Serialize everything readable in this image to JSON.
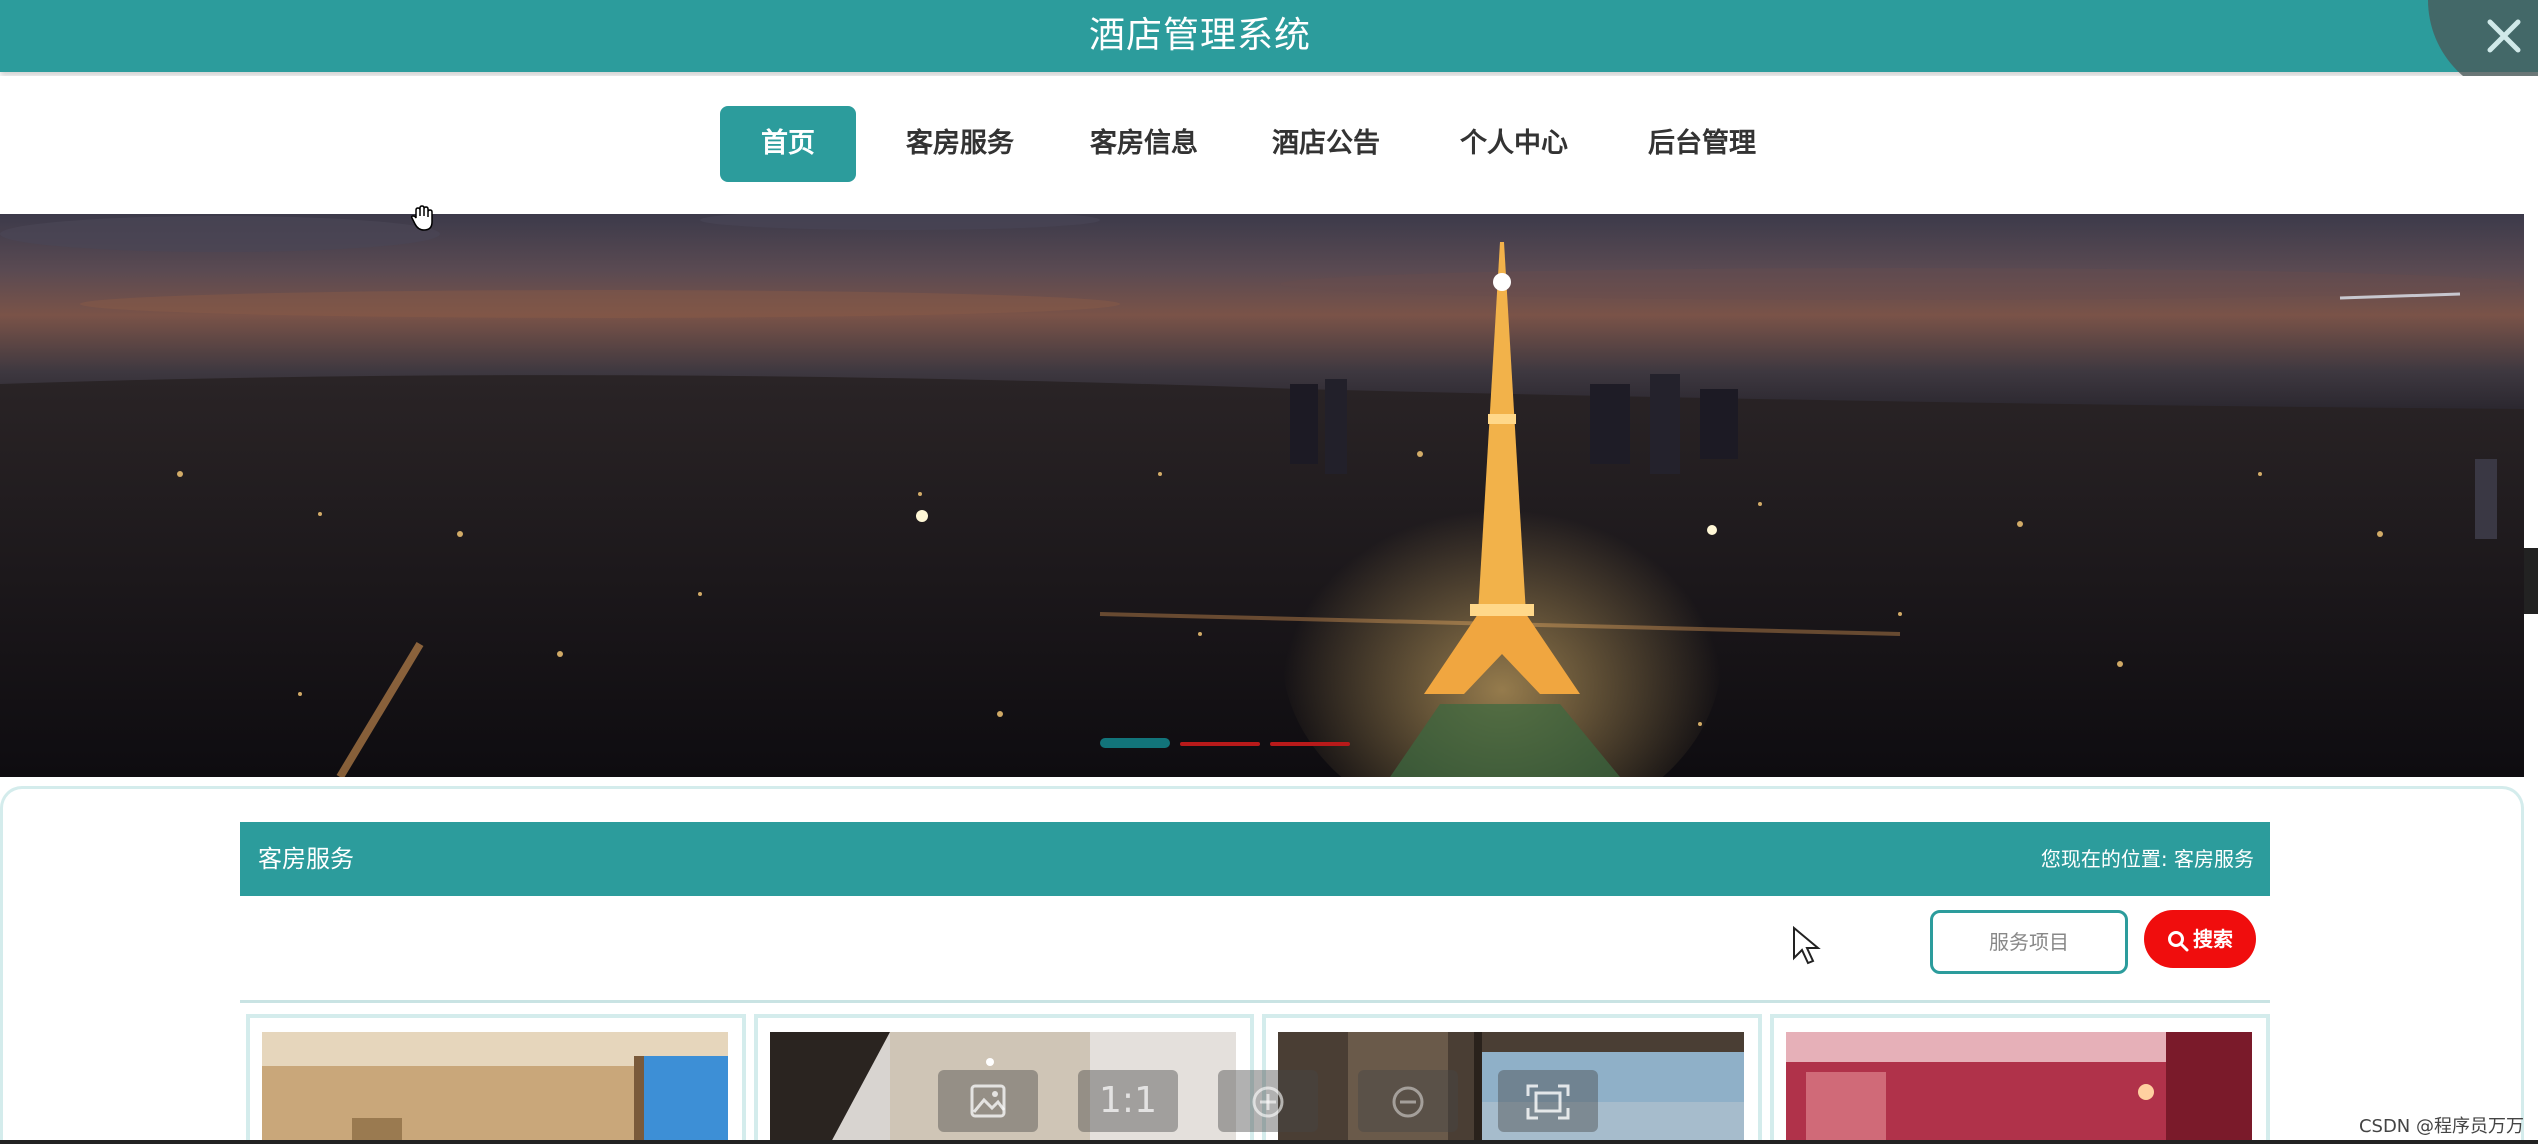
{
  "header": {
    "title": "酒店管理系统"
  },
  "nav": {
    "items": [
      {
        "label": "首页",
        "active": true
      },
      {
        "label": "客房服务",
        "active": false
      },
      {
        "label": "客房信息",
        "active": false
      },
      {
        "label": "酒店公告",
        "active": false
      },
      {
        "label": "个人中心",
        "active": false
      },
      {
        "label": "后台管理",
        "active": false
      }
    ]
  },
  "carousel": {
    "slide_count": 3,
    "active_index": 0
  },
  "section": {
    "title": "客房服务",
    "breadcrumb": "您现在的位置: 客房服务"
  },
  "search": {
    "placeholder": "服务项目",
    "button_label": "搜索"
  },
  "viewer_toolbar": {
    "items": [
      {
        "icon": "image-icon"
      },
      {
        "label": "1:1"
      },
      {
        "icon": "zoom-in-icon"
      },
      {
        "icon": "zoom-out-icon"
      },
      {
        "icon": "fullscreen-icon"
      }
    ]
  },
  "watermark": "CSDN @程序员万万",
  "colors": {
    "primary": "#2c9c9c",
    "search_button": "#f00d0d",
    "panel_border": "#d4ecec"
  }
}
